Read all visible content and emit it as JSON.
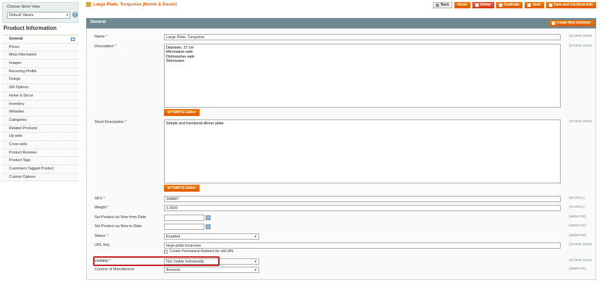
{
  "sidebar": {
    "store_view_label": "Choose Store View:",
    "store_view_value": "Default Values",
    "help_glyph": "?",
    "title": "Product Information",
    "tabs": [
      {
        "label": "General",
        "active": true
      },
      {
        "label": "Prices"
      },
      {
        "label": "Meta Information"
      },
      {
        "label": "Images"
      },
      {
        "label": "Recurring Profile"
      },
      {
        "label": "Design"
      },
      {
        "label": "Gift Options"
      },
      {
        "label": "Home & Decor"
      },
      {
        "label": "Inventory"
      },
      {
        "label": "Websites"
      },
      {
        "label": "Categories"
      },
      {
        "label": "Related Products"
      },
      {
        "label": "Up-sells"
      },
      {
        "label": "Cross-sells"
      },
      {
        "label": "Product Reviews"
      },
      {
        "label": "Product Tags"
      },
      {
        "label": "Customers Tagged Product"
      },
      {
        "label": "Custom Options"
      }
    ]
  },
  "header": {
    "title": "Large Plate, Turquoise (Home & Decor)",
    "buttons": {
      "back": "Back",
      "reset": "Reset",
      "delete": "Delete",
      "duplicate": "Duplicate",
      "save": "Save",
      "save_continue": "Save and Continue Edit"
    }
  },
  "section": {
    "title": "General",
    "create_attribute": "Create New Attribute"
  },
  "form": {
    "name": {
      "label": "Name",
      "value": "Large Plate, Turquoise",
      "scope": "[STORE VIEW]"
    },
    "description": {
      "label": "Description",
      "value": "Diameter, 27 cm\nMicrowave-safe\nDishwasher-safe\nStoneware",
      "scope": "[STORE VIEW]"
    },
    "wysiwyg_label": "WYSIWYG Editor",
    "short_description": {
      "label": "Short Description",
      "value": "Simple and functional dinner plate",
      "scope": "[STORE VIEW]"
    },
    "sku": {
      "label": "SKU",
      "value": "348887",
      "scope": "[GLOBAL]"
    },
    "weight": {
      "label": "Weight",
      "value": "0.3500",
      "scope": "[GLOBAL]"
    },
    "new_from": {
      "label": "Set Product as New from Date",
      "value": "",
      "scope": "[WEBSITE]"
    },
    "new_to": {
      "label": "Set Product as New to Date",
      "value": "",
      "scope": "[WEBSITE]"
    },
    "status": {
      "label": "Status",
      "value": "Enabled",
      "scope": "[WEBSITE]"
    },
    "url_key": {
      "label": "URL Key",
      "value": "large-plate-turquoise",
      "scope": "[STORE VIEW]",
      "checkbox_label": "Create Permanent Redirect for old URL"
    },
    "visibility": {
      "label": "Visibility",
      "value": "Not Visible Individually",
      "scope": "[STORE VIEW]"
    },
    "country": {
      "label": "Country of Manufacture",
      "value": "Armenia",
      "scope": "[WEBSITE]"
    },
    "required_mark": "*"
  },
  "colors": {
    "accent": "#eb5e00",
    "section_header": "#6f8992",
    "highlight": "#c41c1c"
  }
}
